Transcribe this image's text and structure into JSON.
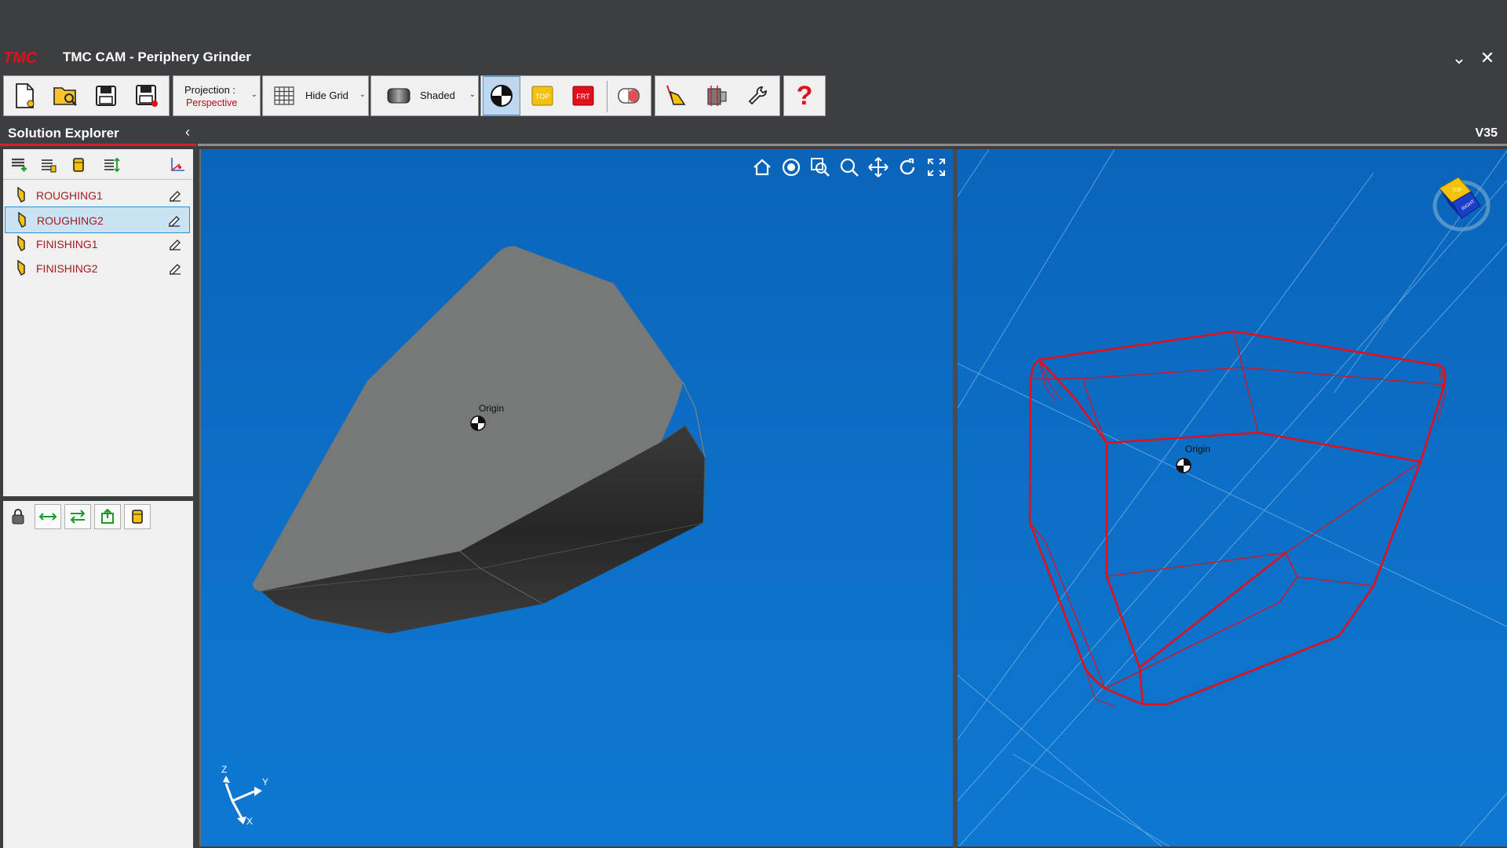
{
  "window": {
    "logo_text": "TMC",
    "title": "TMC CAM - Periphery Grinder",
    "controls": {
      "minimize": "⌄",
      "close": "✕"
    }
  },
  "toolbar": {
    "file_buttons": [
      "new-file-icon",
      "open-folder-icon",
      "save-icon",
      "save-as-icon"
    ],
    "projection": {
      "label": "Projection :",
      "value": "Perspective"
    },
    "grid": {
      "label": "Hide Grid"
    },
    "shade": {
      "label": "Shaded"
    },
    "view_buttons": [
      {
        "icon": "origin-view-icon",
        "active": true
      },
      {
        "icon": "top-view-icon",
        "text": "TOP"
      },
      {
        "icon": "front-view-icon",
        "text": "FRT"
      },
      {
        "icon": "section-view-icon"
      }
    ],
    "tool_buttons": [
      "tool-path-icon",
      "machine-icon",
      "settings-wrench-icon"
    ],
    "help": "?"
  },
  "solution_explorer": {
    "title": "Solution Explorer",
    "collapse": "‹",
    "items": [
      {
        "label": "ROUGHING1",
        "selected": false
      },
      {
        "label": "ROUGHING2",
        "selected": true
      },
      {
        "label": "FINISHING1",
        "selected": false
      },
      {
        "label": "FINISHING2",
        "selected": false
      }
    ]
  },
  "viewport": {
    "version": "V35",
    "origin_label": "Origin",
    "axis_labels": {
      "x": "X",
      "y": "Y",
      "z": "Z"
    },
    "view_cube": {
      "front": "RIGHT",
      "top": "TOP"
    }
  },
  "colors": {
    "brand_red": "#d8202a",
    "viewport_blue": "#0d6fc6",
    "wireframe_red": "#e0101c",
    "selection_blue": "#c9e3f5"
  }
}
